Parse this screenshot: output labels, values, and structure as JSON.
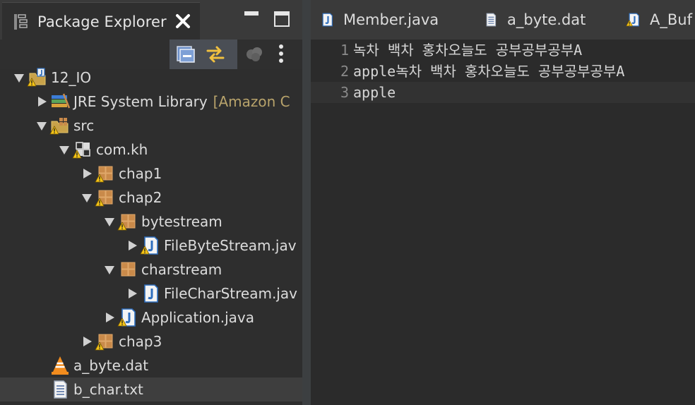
{
  "package_explorer": {
    "tab_title": "Package Explorer",
    "tree": [
      {
        "label": "12_IO",
        "icon": "project-icon",
        "twisty": "expanded",
        "indent": 0
      },
      {
        "label": "JRE System Library",
        "decoration": "[Amazon C",
        "icon": "library-icon",
        "twisty": "collapsed",
        "indent": 1
      },
      {
        "label": "src",
        "icon": "source-folder-icon",
        "twisty": "expanded",
        "indent": 1
      },
      {
        "label": "com.kh",
        "icon": "package-icon",
        "twisty": "expanded",
        "indent": 2
      },
      {
        "label": "chap1",
        "icon": "package-icon",
        "twisty": "collapsed",
        "indent": 3
      },
      {
        "label": "chap2",
        "icon": "package-icon",
        "twisty": "expanded",
        "indent": 3
      },
      {
        "label": "bytestream",
        "icon": "package-icon",
        "twisty": "expanded",
        "indent": 4
      },
      {
        "label": "FileByteStream.jav",
        "icon": "java-file-icon",
        "twisty": "collapsed",
        "indent": 5
      },
      {
        "label": "charstream",
        "icon": "package-icon",
        "twisty": "expanded",
        "indent": 4
      },
      {
        "label": "FileCharStream.jav",
        "icon": "java-file-icon",
        "twisty": "collapsed",
        "indent": 5
      },
      {
        "label": "Application.java",
        "icon": "java-file-icon",
        "twisty": "collapsed",
        "indent": 4
      },
      {
        "label": "chap3",
        "icon": "package-icon",
        "twisty": "collapsed",
        "indent": 3
      },
      {
        "label": "a_byte.dat",
        "icon": "vlc-file-icon",
        "twisty": "none",
        "indent": 1
      },
      {
        "label": "b_char.txt",
        "icon": "text-file-icon",
        "twisty": "none",
        "indent": 1,
        "selected": true
      }
    ]
  },
  "editor": {
    "tabs": [
      {
        "label": "Member.java",
        "icon": "java-file-icon"
      },
      {
        "label": "a_byte.dat",
        "icon": "text-file-icon"
      },
      {
        "label": "A_Buf",
        "icon": "java-file-icon"
      }
    ],
    "lines": [
      {
        "number": "1",
        "text": "녹차 백차 홍차오늘도 공부공부공부A"
      },
      {
        "number": "2",
        "text": "apple녹차 백차 홍차오늘도 공부공부공부A"
      },
      {
        "number": "3",
        "text": "apple"
      }
    ]
  },
  "colors": {
    "warning": "#f5c518",
    "java_blue": "#2f6fbf",
    "package_brown": "#c98a4a",
    "selection": "#3e3e3e"
  }
}
